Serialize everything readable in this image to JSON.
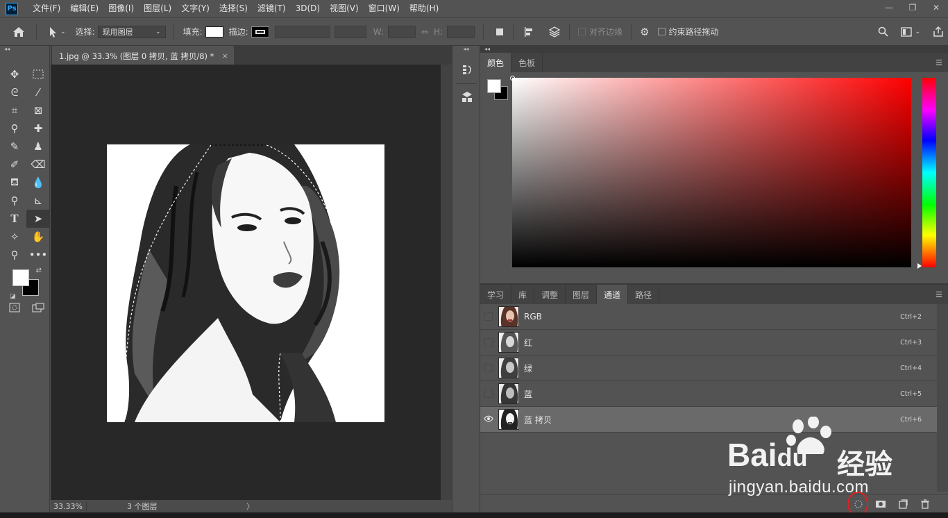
{
  "app": {
    "logo": "Ps"
  },
  "menu": [
    "文件(F)",
    "编辑(E)",
    "图像(I)",
    "图层(L)",
    "文字(Y)",
    "选择(S)",
    "滤镜(T)",
    "3D(D)",
    "视图(V)",
    "窗口(W)",
    "帮助(H)"
  ],
  "window_controls": {
    "minimize": "—",
    "restore": "❐",
    "close": "✕"
  },
  "options": {
    "select_label": "选择:",
    "select_value": "现用图层",
    "fill_label": "填充:",
    "stroke_label": "描边:",
    "w_label": "W:",
    "h_label": "H:",
    "align_edges": "对齐边缘",
    "constrain_path": "约束路径拖动"
  },
  "document": {
    "tab_title": "1.jpg @ 33.3% (图层 0 拷贝, 蓝 拷贝/8) *",
    "close": "×",
    "zoom": "33.33%",
    "layer_count": "3 个图层",
    "status_arrow": "〉"
  },
  "color_panel": {
    "tabs": [
      "颜色",
      "色板"
    ],
    "active_tab": "颜色",
    "foreground": "#ffffff",
    "background": "#000000",
    "hue": "#ff0000"
  },
  "channels_panel": {
    "tabs": [
      "学习",
      "库",
      "调整",
      "图层",
      "通道",
      "路径"
    ],
    "active_tab": "通道",
    "channels": [
      {
        "name": "RGB",
        "shortcut": "Ctrl+2",
        "visible": false,
        "selected": false
      },
      {
        "name": "红",
        "shortcut": "Ctrl+3",
        "visible": false,
        "selected": false
      },
      {
        "name": "绿",
        "shortcut": "Ctrl+4",
        "visible": false,
        "selected": false
      },
      {
        "name": "蓝",
        "shortcut": "Ctrl+5",
        "visible": false,
        "selected": false
      },
      {
        "name": "蓝 拷贝",
        "shortcut": "Ctrl+6",
        "visible": true,
        "selected": true
      }
    ]
  },
  "watermark": {
    "brand": "Bai",
    "brand_du": "du",
    "cn": "经验",
    "url": "jingyan.baidu.com"
  }
}
